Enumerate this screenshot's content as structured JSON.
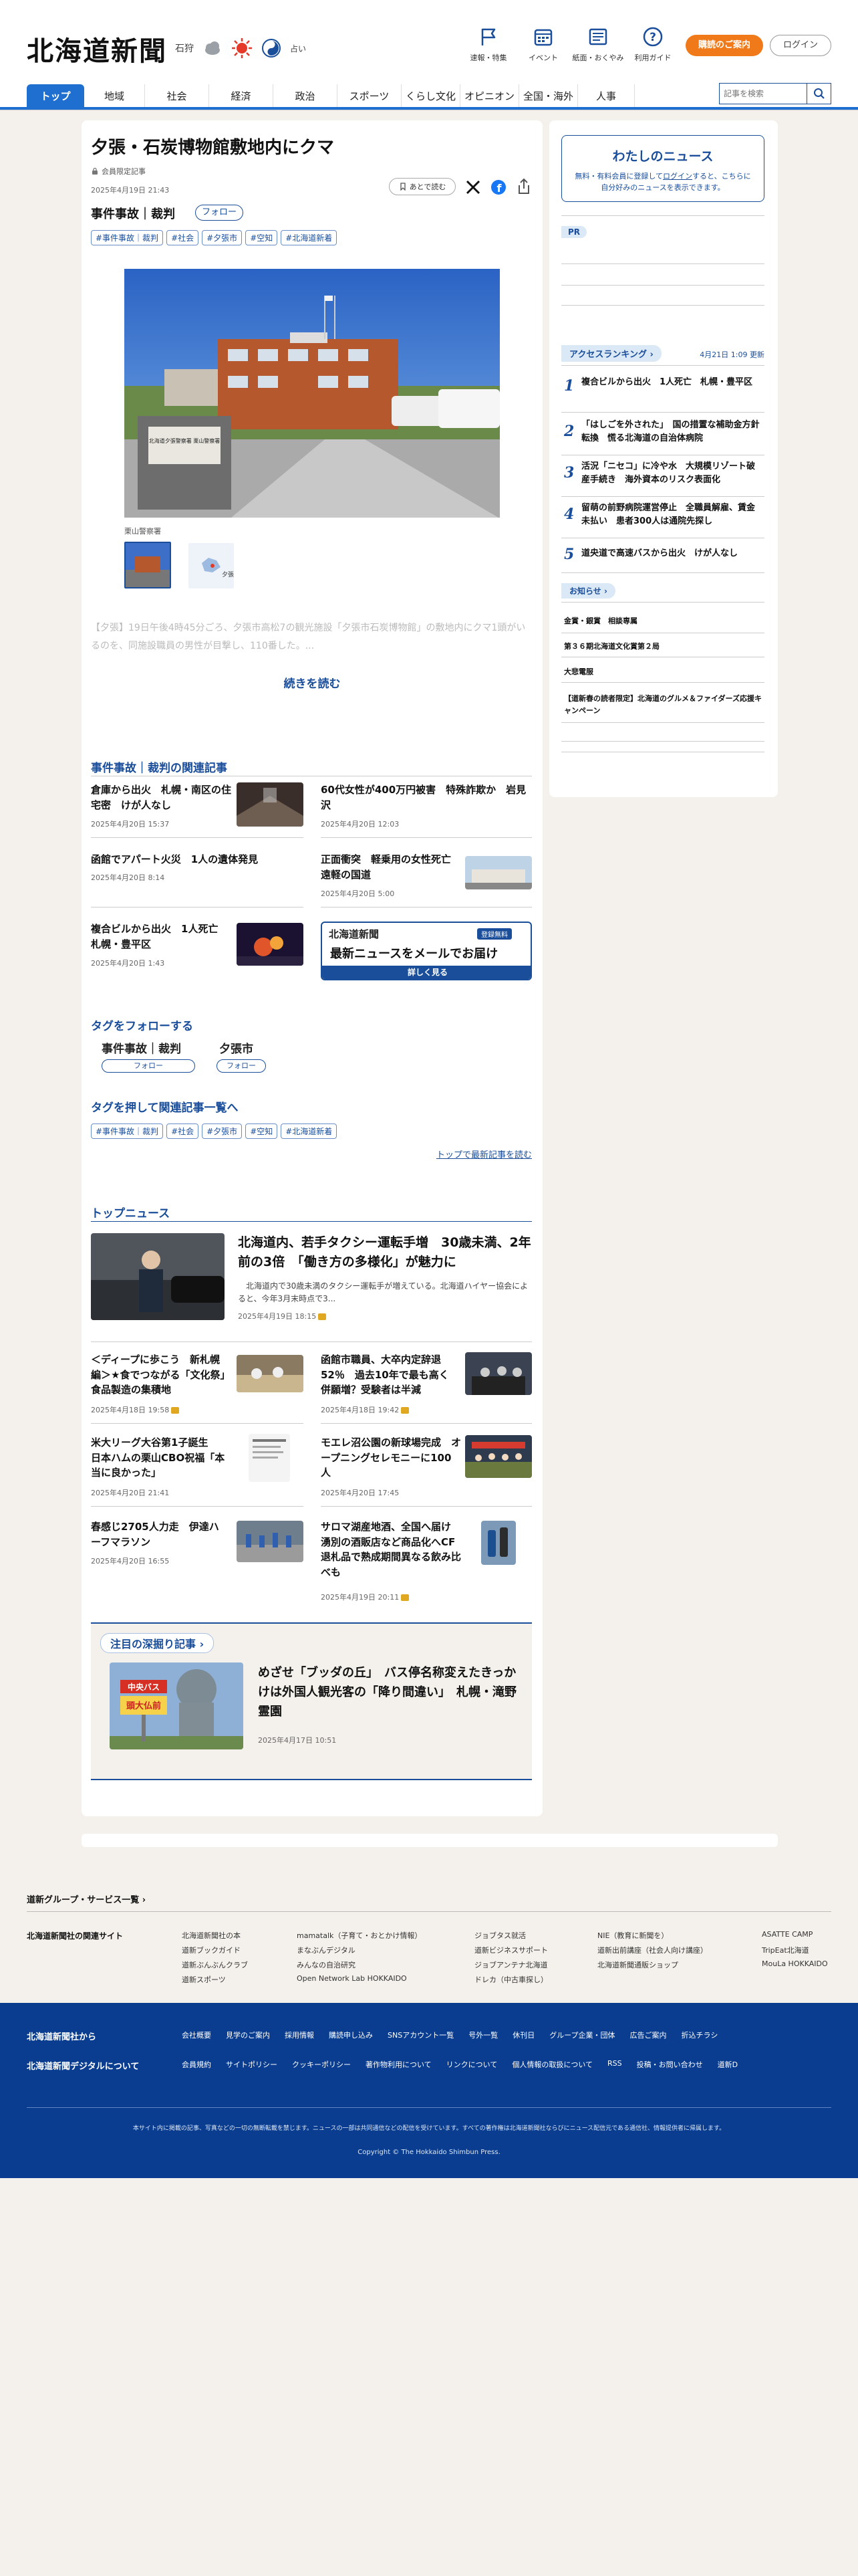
{
  "header": {
    "logo": "北海道新聞",
    "weather_region": "石狩",
    "fortune": "占い",
    "nav": [
      {
        "label": "速報・特集",
        "icon": "flag-icon"
      },
      {
        "label": "イベント",
        "icon": "calendar-icon"
      },
      {
        "label": "紙面・おくやみ",
        "icon": "newspaper-icon"
      },
      {
        "label": "利用ガイド",
        "icon": "question-icon"
      }
    ],
    "subscribe": "購読のご案内",
    "login": "ログイン",
    "search_placeholder": "記事を検索"
  },
  "mainnav": [
    "トップ",
    "地域",
    "社会",
    "経済",
    "政治",
    "スポーツ",
    "くらし文化",
    "オピニオン",
    "全国・海外",
    "人事"
  ],
  "article": {
    "title": "夕張・石炭博物館敷地内にクマ",
    "members_only": "会員限定記事",
    "datetime": "2025年4月19日 21:43",
    "read_later": "あとで読む",
    "category": "事件事故｜裁判",
    "follow": "フォロー",
    "tags": [
      "#事件事故｜裁判",
      "#社会",
      "#夕張市",
      "#空知",
      "#北海道新着"
    ],
    "photo_caption": "栗山警察署",
    "body": "【夕張】19日午後4時45分ごろ、夕張市高松7の観光施設「夕張市石炭博物館」の敷地内にクマ1頭がいるのを、同施設職員の男性が目撃し、110番した。...",
    "read_more": "続きを読む",
    "police_sign": "北海道夕張警察署 栗山警察署"
  },
  "related": {
    "heading": "事件事故｜裁判の関連記事",
    "items": [
      {
        "title": "倉庫から出火　札幌・南区の住宅密　けが人なし",
        "date": "2025年4月20日 15:37"
      },
      {
        "title": "60代女性が400万円被害　特殊詐欺か　岩見沢",
        "date": "2025年4月20日 12:03"
      },
      {
        "title": "函館でアパート火災　1人の遺体発見",
        "date": "2025年4月20日 8:14"
      },
      {
        "title": "正面衝突　軽乗用の女性死亡　遠軽の国道",
        "date": "2025年4月20日 5:00"
      },
      {
        "title": "複合ビルから出火　1人死亡　札幌・豊平区",
        "date": "2025年4月20日 1:43"
      }
    ],
    "promo": {
      "brand": "北海道新聞",
      "badge1": "登録無料",
      "headline": "最新ニュースをメールでお届け",
      "cta": "詳しく見る"
    }
  },
  "follow_tags": {
    "heading": "タグをフォローする",
    "items": [
      "事件事故｜裁判",
      "夕張市"
    ],
    "button": "フォロー"
  },
  "tag_links": {
    "heading": "タグを押して関連記事一覧へ",
    "tags": [
      "#事件事故｜裁判",
      "#社会",
      "#夕張市",
      "#空知",
      "#北海道新着"
    ],
    "latest": "トップで最新記事を読む"
  },
  "top_news": {
    "heading": "トップニュース",
    "lead": {
      "title": "北海道内、若手タクシー運転手増　30歳未満、2年前の3倍　「働き方の多様化」が魅力に",
      "summary": "北海道内で30歳未満のタクシー運転手が増えている。北海道ハイヤー協会によると、今年3月末時点で3...",
      "date": "2025年4月19日 18:15"
    },
    "items": [
      {
        "title": "＜ディープに歩こう　新札幌編＞★食でつながる「文化祭」　食品製造の集積地",
        "date": "2025年4月18日 19:58"
      },
      {
        "title": "函館市職員、大卒内定辞退52％　過去10年で最も高く　併願増？受験者は半減",
        "date": "2025年4月18日 19:42"
      },
      {
        "title": "米大リーグ大谷第1子誕生　日本ハムの栗山CBO祝福「本当に良かった」",
        "date": "2025年4月20日 21:41"
      },
      {
        "title": "モエレ沼公園の新球場完成　オープニングセレモニーに100人",
        "date": "2025年4月20日 17:45"
      },
      {
        "title": "春感じ2705人力走　伊達ハーフマラソン",
        "date": "2025年4月20日 16:55"
      },
      {
        "title": "サロマ湖産地酒、全国へ届け　湧別の酒販店など商品化へCF　退札品で熟成期間異なる飲み比べも",
        "date": "2025年4月19日 20:11"
      }
    ]
  },
  "deep_dive": {
    "heading": "注目の深掘り記事",
    "title": "めざせ「ブッダの丘」　バス停名称変えたきっかけは外国人観光客の「降り間違い」　札幌・滝野霊園",
    "date": "2025年4月17日 10:51",
    "bus_sign": "中央バス",
    "bus_stop": "頭大仏前"
  },
  "sidebar": {
    "my_news_title": "わたしのニュース",
    "my_news_text1": "無料・有料会員に登録して",
    "my_news_login": "ログイン",
    "my_news_text2": "すると、こちらに自分好みのニュースを表示できます。",
    "pr": "PR",
    "ranking_title": "アクセスランキング",
    "ranking_updated": "4月21日 1:09 更新",
    "ranking": [
      {
        "num": "1",
        "title": "複合ビルから出火　1人死亡　札幌・豊平区"
      },
      {
        "num": "2",
        "title": "「はしごを外された」　国の措置な補助金方針転換　慌る北海道の自治体病院"
      },
      {
        "num": "3",
        "title": "活況「ニセコ」に冷や水　大規模リゾート破産手続き　海外資本のリスク表面化"
      },
      {
        "num": "4",
        "title": "留萌の前野病院運営停止　全職員解雇、賃金未払い　患者300人は通院先探し"
      },
      {
        "num": "5",
        "title": "道央道で高速バスから出火　けが人なし"
      }
    ],
    "notice_title": "お知らせ",
    "notices": [
      "金賞・銀賞　相談専属",
      "第３６期北海道文化賞第２局",
      "大悲電服",
      "【道新春の読者限定】北海道のグルメ＆ファイダーズ応援キャンペーン"
    ]
  },
  "group": {
    "heading": "道新グループ・サービス一覧",
    "sites_label": "北海道新聞社の関連サイト",
    "cols": [
      [
        "北海道新聞社の本",
        "道新ブックガイド",
        "道新ぶんぶんクラブ",
        "道新スポーツ"
      ],
      [
        "mamatalk（子育て・おとかけ情報）",
        "まなぶんデジタル",
        "みんなの自治研究",
        "Open Network Lab HOKKAIDO"
      ],
      [
        "ジョブタス就活",
        "道新ビジネスサポート",
        "ジョブアンテナ北海道",
        "ドレカ（中古車探し）"
      ],
      [
        "NIE（教育に新聞を）",
        "道新出前講座（社会人向け講座）",
        "北海道新聞通販ショップ"
      ],
      [
        "ASATTE CAMP",
        "TripEat北海道",
        "MouLa HOKKAIDO"
      ]
    ]
  },
  "footer": {
    "left1": "北海道新聞社から",
    "left2": "北海道新聞デジタルについて",
    "row1": [
      "会社概要",
      "見学のご案内",
      "採用情報",
      "購読申し込み",
      "SNSアカウント一覧",
      "号外一覧",
      "休刊日",
      "グループ企業・団体",
      "広告ご案内",
      "折込チラシ"
    ],
    "row2": [
      "会員規約",
      "サイトポリシー",
      "クッキーポリシー",
      "著作物利用について",
      "リンクについて",
      "個人情報の取扱について",
      "RSS",
      "投稿・お問い合わせ",
      "道新D"
    ],
    "notice": "本サイト内に掲載の記事、写真などの一切の無断転載を禁じます。ニュースの一部は共同通信などの配信を受けています。すべての著作権は北海道新聞社ならびにニュース配信元である通信社、情報提供者に帰属します。",
    "copyright": "Copyright © The Hokkaido Shimbun Press."
  }
}
